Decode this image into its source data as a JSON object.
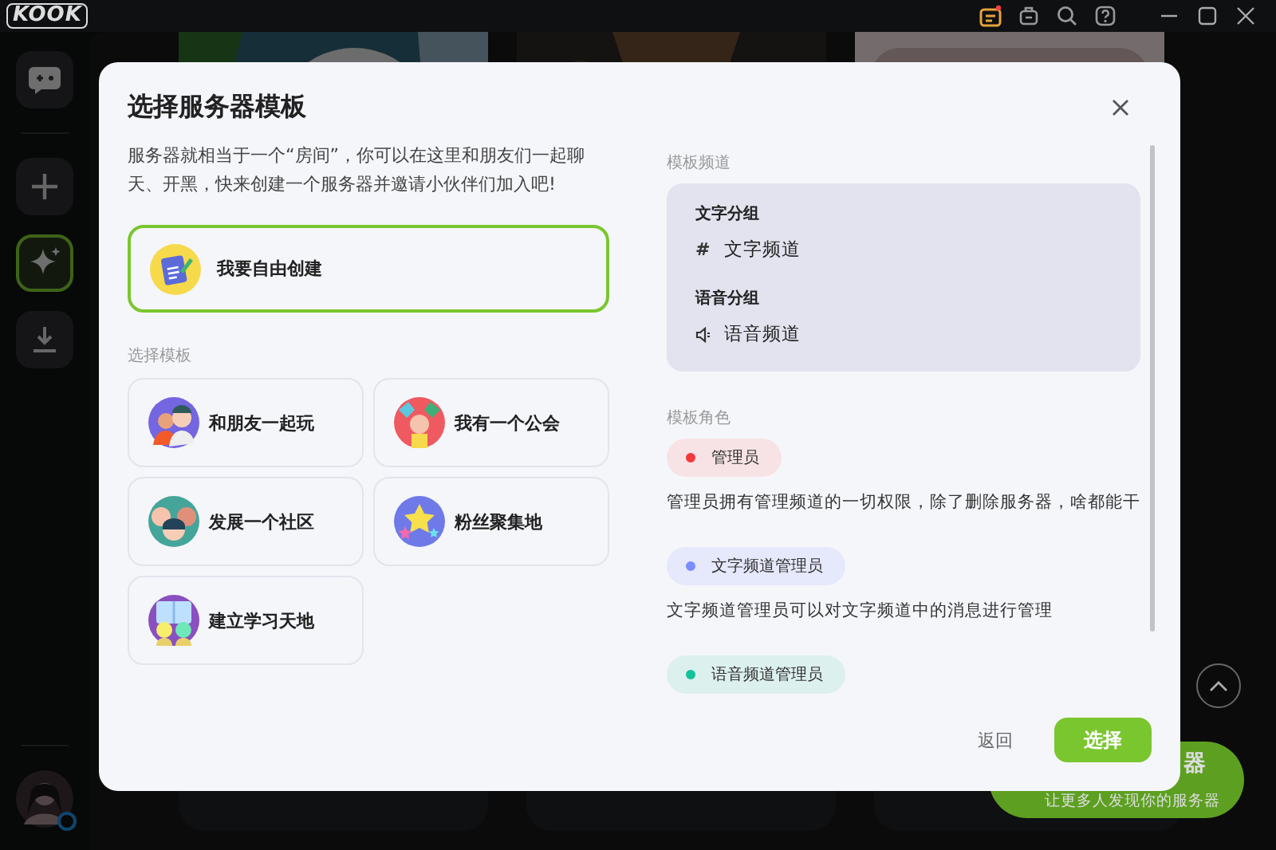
{
  "app": {
    "logo": "KOOK"
  },
  "sidebar": {
    "items": [
      {
        "kind": "chat",
        "selected": false
      },
      {
        "kind": "add",
        "selected": false
      },
      {
        "kind": "discover",
        "selected": true
      },
      {
        "kind": "download",
        "selected": false
      }
    ]
  },
  "promo": {
    "title": "器",
    "subtitle": "让更多人发现你的服务器"
  },
  "dialog": {
    "title": "选择服务器模板",
    "description": "服务器就相当于一个“房间”，你可以在这里和朋友们一起聊天、开黑，快来创建一个服务器并邀请小伙伴们加入吧!",
    "free_create": {
      "label": "我要自由创建",
      "selected": true
    },
    "templates_label": "选择模板",
    "templates": [
      {
        "label": "和朋友一起玩",
        "kind": "friends",
        "selected": false
      },
      {
        "label": "我有一个公会",
        "kind": "guild",
        "selected": false
      },
      {
        "label": "发展一个社区",
        "kind": "community",
        "selected": false
      },
      {
        "label": "粉丝聚集地",
        "kind": "fans",
        "selected": false
      },
      {
        "label": "建立学习天地",
        "kind": "study",
        "selected": false
      }
    ],
    "channels_label": "模板频道",
    "channel_groups": [
      {
        "name": "文字分组",
        "channels": [
          {
            "kind": "text",
            "icon": "#",
            "name": "文字频道"
          }
        ]
      },
      {
        "name": "语音分组",
        "channels": [
          {
            "kind": "voice",
            "name": "语音频道"
          }
        ]
      }
    ],
    "roles_label": "模板角色",
    "roles": [
      {
        "name": "管理员",
        "color": "#f23a3a",
        "description": "管理员拥有管理频道的一切权限，除了删除服务器，啥都能干"
      },
      {
        "name": "文字频道管理员",
        "color": "#7b8cff",
        "description": "文字频道管理员可以对文字频道中的消息进行管理"
      },
      {
        "name": "语音频道管理员",
        "color": "#12c29b"
      }
    ],
    "back_button": "返回",
    "confirm_button": "选择"
  }
}
